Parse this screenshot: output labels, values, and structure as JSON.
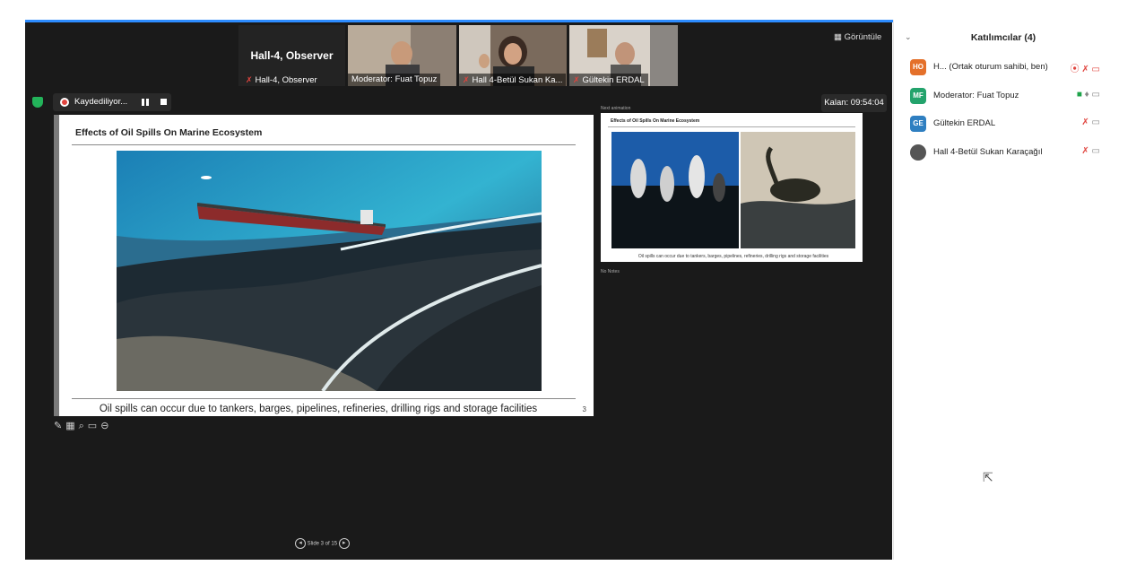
{
  "strip": {
    "self_title": "Hall-4, Observer",
    "self_label": "Hall-4, Observer",
    "tiles": [
      {
        "label": "Moderator: Fuat Topuz"
      },
      {
        "label": "Hall 4-Betül Sukan Ka..."
      },
      {
        "label": "Gültekin ERDAL"
      }
    ],
    "view_button": "Görüntüle"
  },
  "recording": {
    "status": "Kaydediliyor..."
  },
  "timer": {
    "label": "Kalan: 09:54:04"
  },
  "slide": {
    "title": "Effects of Oil Spills On Marine Ecosystem",
    "caption": "Oil spills can occur due to tankers, barges, pipelines, refineries, drilling rigs and storage facilities",
    "number": "3"
  },
  "preview": {
    "title": "Effects of Oil Spills On Marine Ecosystem",
    "caption": "Oil spills can occur due to tankers, barges, pipelines, refineries, drilling rigs and storage facilities",
    "next_label": "Next animation",
    "notes": "No Notes"
  },
  "nav": {
    "page": "Slide 3 of 15"
  },
  "participants": {
    "title": "Katılımcılar (4)",
    "items": [
      {
        "initials": "HO",
        "name": "H... (Ortak oturum sahibi, ben)",
        "color": "#e4702a"
      },
      {
        "initials": "MF",
        "name": "Moderator: Fuat Topuz",
        "color": "#23a36c"
      },
      {
        "initials": "GE",
        "name": "Gültekin ERDAL",
        "color": "#2f7fc1"
      },
      {
        "initials": "",
        "name": "Hall 4-Betül Sukan Karaçağıl",
        "color": "#555555"
      }
    ]
  },
  "colors": {
    "accent": "#2d8cff",
    "meeting_bg": "#1a1a1a",
    "muted": "#e0443e"
  }
}
